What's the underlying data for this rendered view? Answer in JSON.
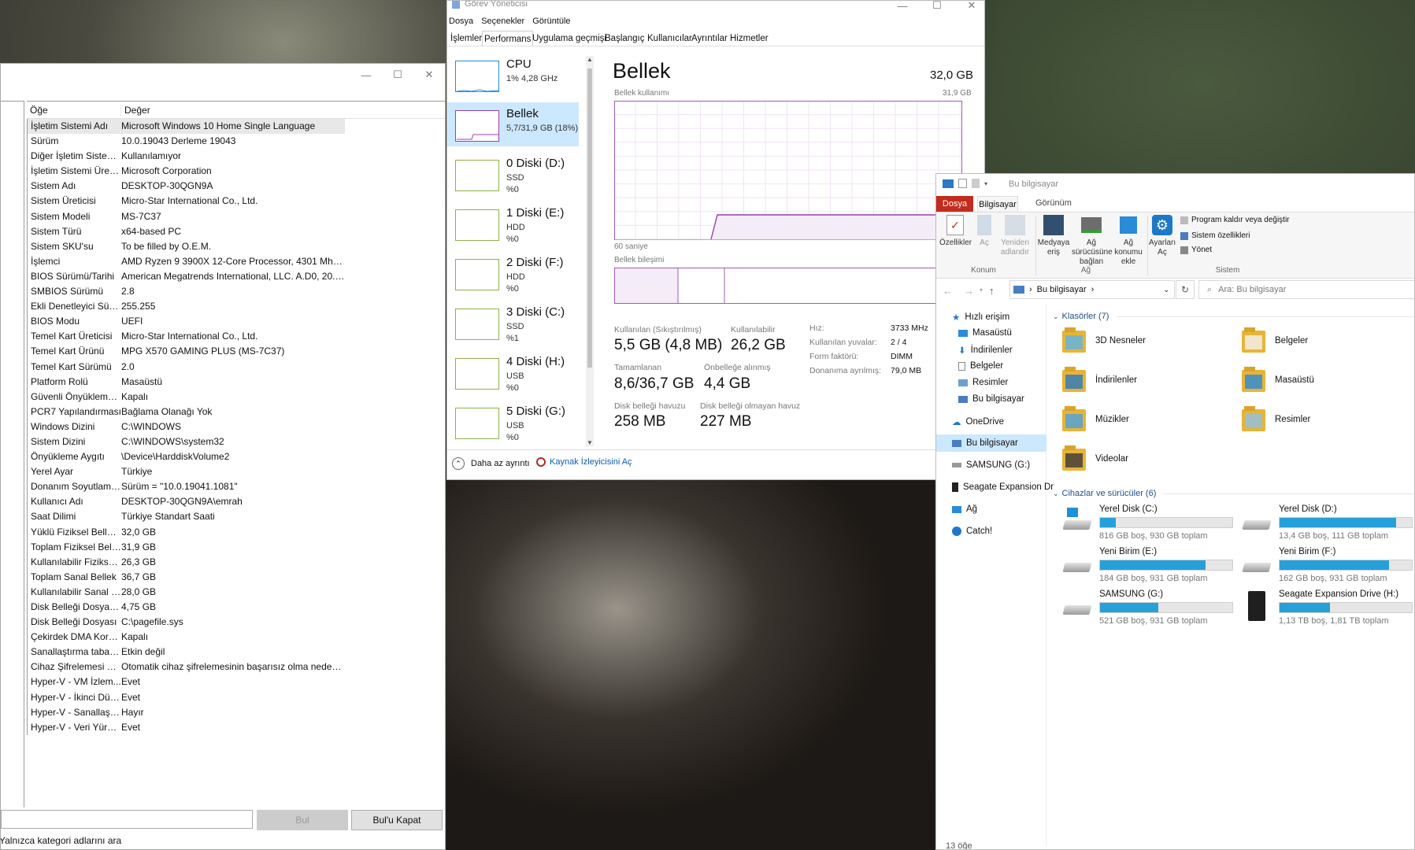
{
  "sysinfo": {
    "header": {
      "item": "Öğe",
      "value": "Değer"
    },
    "rows": [
      [
        "İşletim Sistemi Adı",
        "Microsoft Windows 10 Home Single Language"
      ],
      [
        "Sürüm",
        "10.0.19043 Derleme 19043"
      ],
      [
        "Diğer İşletim Sistemi...",
        "Kullanılamıyor"
      ],
      [
        "İşletim Sistemi Üreti...",
        "Microsoft Corporation"
      ],
      [
        "Sistem Adı",
        "DESKTOP-30QGN9A"
      ],
      [
        "Sistem Üreticisi",
        "Micro-Star International Co., Ltd."
      ],
      [
        "Sistem Modeli",
        "MS-7C37"
      ],
      [
        "Sistem Türü",
        "x64-based PC"
      ],
      [
        "Sistem SKU'su",
        "To be filled by O.E.M."
      ],
      [
        "İşlemci",
        "AMD Ryzen 9 3900X 12-Core Processor, 4301 Mhz, ..."
      ],
      [
        "BIOS Sürümü/Tarihi",
        "American Megatrends International, LLC. A.D0, 20.0..."
      ],
      [
        "SMBIOS Sürümü",
        "2.8"
      ],
      [
        "Ekli Denetleyici Sürü...",
        "255.255"
      ],
      [
        "BIOS Modu",
        "UEFI"
      ],
      [
        "Temel Kart Üreticisi",
        "Micro-Star International Co., Ltd."
      ],
      [
        "Temel Kart Ürünü",
        "MPG X570 GAMING PLUS (MS-7C37)"
      ],
      [
        "Temel Kart Sürümü",
        "2.0"
      ],
      [
        "Platform Rolü",
        "Masaüstü"
      ],
      [
        "Güvenli Önyükleme ...",
        "Kapalı"
      ],
      [
        "PCR7 Yapılandırması",
        "Bağlama Olanağı Yok"
      ],
      [
        "Windows Dizini",
        "C:\\WINDOWS"
      ],
      [
        "Sistem Dizini",
        "C:\\WINDOWS\\system32"
      ],
      [
        "Önyükleme Aygıtı",
        "\\Device\\HarddiskVolume2"
      ],
      [
        "Yerel Ayar",
        "Türkiye"
      ],
      [
        "Donanım Soyutlama...",
        "Sürüm = \"10.0.19041.1081\""
      ],
      [
        "Kullanıcı Adı",
        "DESKTOP-30QGN9A\\emrah"
      ],
      [
        "Saat Dilimi",
        "Türkiye Standart Saati"
      ],
      [
        "Yüklü Fiziksel Bellek ...",
        "32,0 GB"
      ],
      [
        "Toplam Fiziksel Bellek",
        "31,9 GB"
      ],
      [
        "Kullanılabilir Fiziksel ...",
        "26,3 GB"
      ],
      [
        "Toplam Sanal Bellek",
        "36,7 GB"
      ],
      [
        "Kullanılabilir Sanal B...",
        "28,0 GB"
      ],
      [
        "Disk Belleği Dosyası ...",
        "4,75 GB"
      ],
      [
        "Disk Belleği Dosyası",
        "C:\\pagefile.sys"
      ],
      [
        "Çekirdek DMA Koru...",
        "Kapalı"
      ],
      [
        "Sanallaştırma tabanl...",
        "Etkin değil"
      ],
      [
        "Cihaz Şifrelemesi De...",
        "Otomatik cihaz şifrelemesinin başarısız olma nedenl..."
      ],
      [
        "Hyper-V - VM İzlem...",
        "Evet"
      ],
      [
        "Hyper-V - İkinci Düz...",
        "Evet"
      ],
      [
        "Hyper-V - Sanallaştır...",
        "Hayır"
      ],
      [
        "Hyper-V - Veri Yürüt...",
        "Evet"
      ]
    ],
    "find_button": "Bul",
    "close_find_button": "Bul'u Kapat",
    "search_category": "Yalnızca kategori adlarını ara"
  },
  "taskmgr": {
    "title": "Görev Yöneticisi",
    "menu": [
      "Dosya",
      "Seçenekler",
      "Görüntüle"
    ],
    "tabs": [
      "İşlemler",
      "Performans",
      "Uygulama geçmişi",
      "Başlangıç",
      "Kullanıcılar",
      "Ayrıntılar",
      "Hizmetler"
    ],
    "perf_items": [
      {
        "name": "CPU",
        "l2": "1% 4,28 GHz",
        "l3": ""
      },
      {
        "name": "Bellek",
        "l2": "5,7/31,9 GB (18%)",
        "l3": ""
      },
      {
        "name": "0 Diski (D:)",
        "l2": "SSD",
        "l3": "%0"
      },
      {
        "name": "1 Diski (E:)",
        "l2": "HDD",
        "l3": "%0"
      },
      {
        "name": "2 Diski (F:)",
        "l2": "HDD",
        "l3": "%0"
      },
      {
        "name": "3 Diski (C:)",
        "l2": "SSD",
        "l3": "%1"
      },
      {
        "name": "4 Diski (H:)",
        "l2": "USB",
        "l3": "%0"
      },
      {
        "name": "5 Diski (G:)",
        "l2": "USB",
        "l3": "%0"
      }
    ],
    "memory": {
      "title": "Bellek",
      "total": "32,0 GB",
      "usage_label": "Bellek kullanımı",
      "usage_max": "31,9 GB",
      "seconds": "60 saniye",
      "composition": "Bellek bileşimi",
      "in_use_label": "Kullanılan (Sıkıştırılmış)",
      "in_use": "5,5 GB (4,8 MB)",
      "available_label": "Kullanılabilir",
      "available": "26,2 GB",
      "committed_label": "Tamamlanan",
      "committed": "8,6/36,7 GB",
      "cached_label": "Önbelleğe alınmış",
      "cached": "4,4 GB",
      "paged_label": "Disk belleği havuzu",
      "paged": "258 MB",
      "nonpaged_label": "Disk belleği olmayan havuz",
      "nonpaged": "227 MB",
      "speed_label": "Hız:",
      "speed": "3733 MHz",
      "slots_label": "Kullanılan yuvalar:",
      "slots": "2 / 4",
      "form_label": "Form faktörü:",
      "form": "DIMM",
      "reserved_label": "Donanıma ayrılmış:",
      "reserved": "79,0 MB"
    },
    "fewer_details": "Daha az ayrıntı",
    "resource_monitor": "Kaynak İzleyicisini Aç"
  },
  "explorer": {
    "title": "Bu bilgisayar",
    "tabs": [
      "Dosya",
      "Bilgisayar",
      "Görünüm"
    ],
    "ribbon": {
      "properties": "Özellikler",
      "open": "Aç",
      "rename": "Yeniden adlandır",
      "media": "Medyaya eriş",
      "map_drive": "Ağ sürücüsüne bağlan",
      "add_location": "Ağ konumu ekle",
      "settings": "Ayarları Aç",
      "uninstall": "Program kaldır veya değiştir",
      "sys_props": "Sistem özellikleri",
      "manage": "Yönet",
      "group_location": "Konum",
      "group_network": "Ağ",
      "group_system": "Sistem"
    },
    "address": "Bu bilgisayar",
    "search_placeholder": "Ara: Bu bilgisayar",
    "nav": [
      "Hızlı erişim",
      "Masaüstü",
      "İndirilenler",
      "Belgeler",
      "Resimler",
      "Bu bilgisayar",
      "OneDrive",
      "Bu bilgisayar",
      "SAMSUNG  (G:)",
      "Seagate Expansion Dr",
      "Ağ",
      "Catch!"
    ],
    "folders_header": "Klasörler (7)",
    "folders": [
      "3D Nesneler",
      "Belgeler",
      "İndirilenler",
      "Masaüstü",
      "Müzikler",
      "Resimler",
      "Videolar"
    ],
    "devices_header": "Cihazlar ve sürücüler (6)",
    "drives": [
      {
        "name": "Yerel Disk (C:)",
        "info": "816 GB boş, 930 GB toplam",
        "used": 0.12
      },
      {
        "name": "Yerel Disk (D:)",
        "info": "13,4 GB boş, 111 GB toplam",
        "used": 0.88
      },
      {
        "name": "Yeni Birim (E:)",
        "info": "184 GB boş, 931 GB toplam",
        "used": 0.8
      },
      {
        "name": "Yeni Birim (F:)",
        "info": "162 GB boş, 931 GB toplam",
        "used": 0.83
      },
      {
        "name": "SAMSUNG  (G:)",
        "info": "521 GB boş, 931 GB toplam",
        "used": 0.44
      },
      {
        "name": "Seagate Expansion Drive (H:)",
        "info": "1,13 TB boş, 1,81 TB toplam",
        "used": 0.38
      }
    ],
    "status": "13 öğe",
    "colors": {
      "accent": "#26a0da",
      "file_tab": "#c42b1c",
      "memory_purple": "#8b12ae"
    }
  }
}
